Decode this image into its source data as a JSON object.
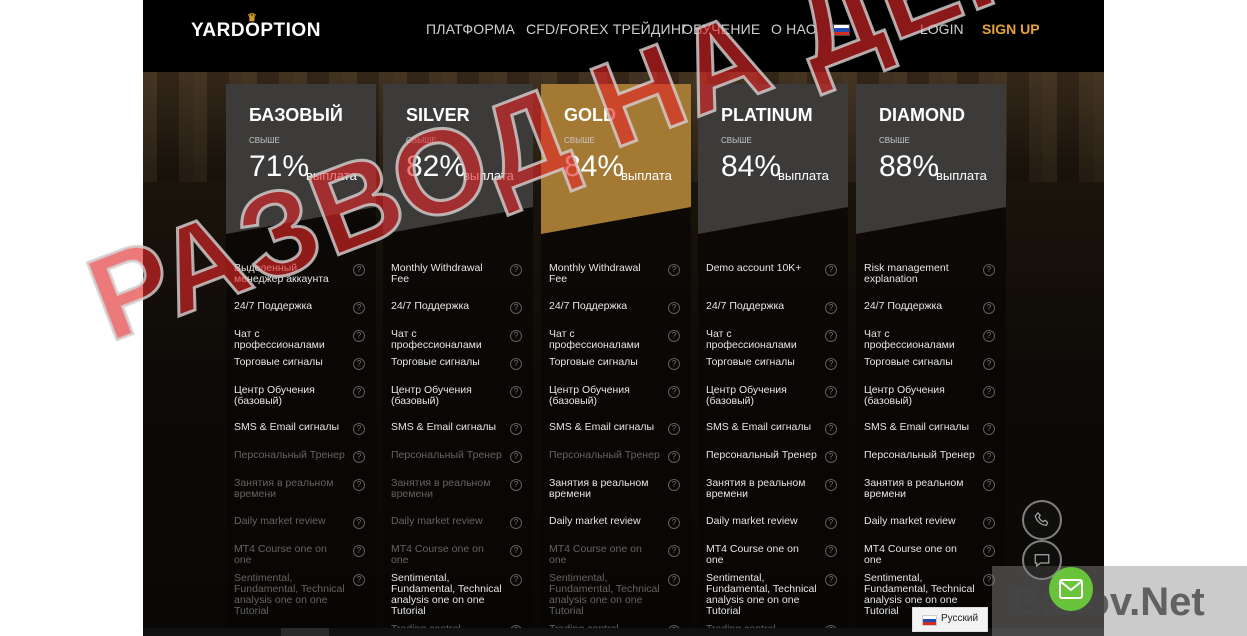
{
  "brand": {
    "name": "YARDOPTION",
    "crown_glyph": "♛",
    "accent": "#e7a33a"
  },
  "nav": {
    "items": [
      "ПЛАТФОРМА",
      "CFD/FOREX ТРЕЙДИНГ",
      "ОБУЧЕНИЕ",
      "О НАС"
    ],
    "login": "LOGIN",
    "signup": "SIGN UP"
  },
  "plans": [
    {
      "name": "БАЗОВЫЙ",
      "above": "СВЫШЕ",
      "percent": "71%",
      "payout": "выплата",
      "color": "#3c3b3a",
      "features": [
        {
          "text": "Выделенный менеджер аккаунта",
          "active": true
        },
        {
          "text": "24/7 Поддержка",
          "active": true
        },
        {
          "text": "Чат с профессионалами",
          "active": true
        },
        {
          "text": "Торговые сигналы",
          "active": true
        },
        {
          "text": "Центр Обучения (базовый)",
          "active": true
        },
        {
          "text": "SMS & Email сигналы",
          "active": true
        },
        {
          "text": "Персональный Тренер",
          "active": false
        },
        {
          "text": "Занятия в реальном времени",
          "active": false
        },
        {
          "text": "Daily market review",
          "active": false
        },
        {
          "text": "MT4 Course one on one",
          "active": false
        },
        {
          "text": "Sentimental, Fundamental, Technical analysis one on one Tutorial",
          "active": false
        }
      ]
    },
    {
      "name": "SILVER",
      "above": "СВЫШЕ",
      "percent": "82%",
      "payout": "выплата",
      "color": "#3c3b3a",
      "features": [
        {
          "text": "Monthly Withdrawal Fee",
          "active": true
        },
        {
          "text": "24/7 Поддержка",
          "active": true
        },
        {
          "text": "Чат с профессионалами",
          "active": true
        },
        {
          "text": "Торговые сигналы",
          "active": true
        },
        {
          "text": "Центр Обучения (базовый)",
          "active": true
        },
        {
          "text": "SMS & Email сигналы",
          "active": true
        },
        {
          "text": "Персональный Тренер",
          "active": false
        },
        {
          "text": "Занятия в реальном времени",
          "active": false
        },
        {
          "text": "Daily market review",
          "active": false
        },
        {
          "text": "MT4 Course one on one",
          "active": false
        },
        {
          "text": "Sentimental, Fundamental, Technical analysis one on one Tutorial",
          "active": true
        },
        {
          "text": "Trading control",
          "active": false
        }
      ]
    },
    {
      "name": "GOLD",
      "above": "СВЫШЕ",
      "percent": "84%",
      "payout": "выплата",
      "color": "#a47934",
      "features": [
        {
          "text": "Monthly Withdrawal Fee",
          "active": true
        },
        {
          "text": "24/7 Поддержка",
          "active": true
        },
        {
          "text": "Чат с профессионалами",
          "active": true
        },
        {
          "text": "Торговые сигналы",
          "active": true
        },
        {
          "text": "Центр Обучения (базовый)",
          "active": true
        },
        {
          "text": "SMS & Email сигналы",
          "active": true
        },
        {
          "text": "Персональный Тренер",
          "active": false
        },
        {
          "text": "Занятия в реальном времени",
          "active": true
        },
        {
          "text": "Daily market review",
          "active": true
        },
        {
          "text": "MT4 Course one on one",
          "active": false
        },
        {
          "text": "Sentimental, Fundamental, Technical analysis one on one Tutorial",
          "active": false
        },
        {
          "text": "Trading control",
          "active": false
        }
      ]
    },
    {
      "name": "PLATINUM",
      "above": "СВЫШЕ",
      "percent": "84%",
      "payout": "выплата",
      "color": "#3c3b3a",
      "features": [
        {
          "text": "Demo account 10K+",
          "active": true
        },
        {
          "text": "24/7 Поддержка",
          "active": true
        },
        {
          "text": "Чат с профессионалами",
          "active": true
        },
        {
          "text": "Торговые сигналы",
          "active": true
        },
        {
          "text": "Центр Обучения (базовый)",
          "active": true
        },
        {
          "text": "SMS & Email сигналы",
          "active": true
        },
        {
          "text": "Персональный Тренер",
          "active": true
        },
        {
          "text": "Занятия в реальном времени",
          "active": true
        },
        {
          "text": "Daily market review",
          "active": true
        },
        {
          "text": "MT4 Course one on one",
          "active": true
        },
        {
          "text": "Sentimental, Fundamental, Technical analysis one on one Tutorial",
          "active": true
        },
        {
          "text": "Trading control",
          "active": false
        }
      ]
    },
    {
      "name": "DIAMOND",
      "above": "СВЫШЕ",
      "percent": "88%",
      "payout": "выплата",
      "color": "#3c3b3a",
      "features": [
        {
          "text": "Risk management explanation",
          "active": true
        },
        {
          "text": "24/7 Поддержка",
          "active": true
        },
        {
          "text": "Чат с профессионалами",
          "active": true
        },
        {
          "text": "Торговые сигналы",
          "active": true
        },
        {
          "text": "Центр Обучения (базовый)",
          "active": true
        },
        {
          "text": "SMS & Email сигналы",
          "active": true
        },
        {
          "text": "Персональный Тренер",
          "active": true
        },
        {
          "text": "Занятия в реальном времени",
          "active": true
        },
        {
          "text": "Daily market review",
          "active": true
        },
        {
          "text": "MT4 Course one on one",
          "active": true
        },
        {
          "text": "Sentimental, Fundamental, Technical analysis one on one Tutorial",
          "active": true
        }
      ]
    }
  ],
  "help_glyph": "?",
  "language": {
    "label": "Русский"
  },
  "stamp": {
    "text": "РАЗВОД НА ДЕНЬГИ",
    "color": "#e22828"
  },
  "watermark": {
    "text": "Baxov.Net"
  },
  "widgets": {
    "phone_icon": "phone-icon",
    "chat_icon": "chat-icon",
    "mail_icon": "mail-icon"
  }
}
